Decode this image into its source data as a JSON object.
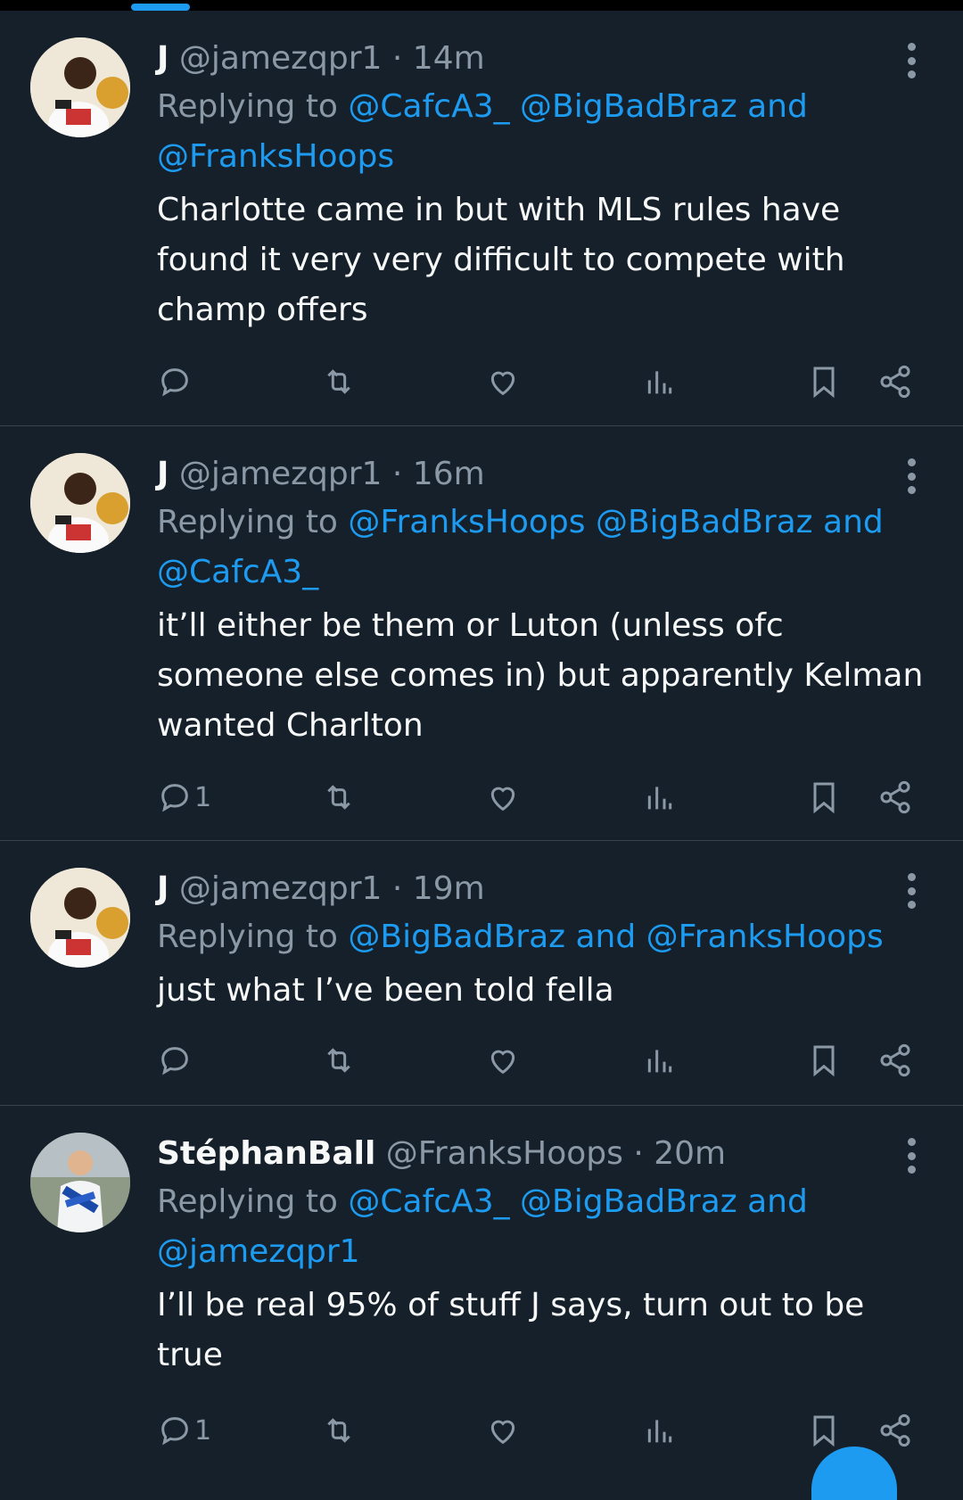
{
  "colors": {
    "background": "#15202b",
    "accent": "#1d9bf0",
    "muted": "#8b98a5",
    "divider": "#38444d"
  },
  "tweets": [
    {
      "name": "J",
      "handle": "@jamezqpr1",
      "time": "· 14m",
      "reply_prefix": "Replying to",
      "reply_line1": "@CafcA3_ @BigBadBraz and",
      "reply_line2": "@FranksHoops",
      "text": "Charlotte came in but with MLS rules have found it very very difficult to compete with champ offers",
      "reply_count": ""
    },
    {
      "name": "J",
      "handle": "@jamezqpr1",
      "time": "· 16m",
      "reply_prefix": "Replying to",
      "reply_line1": "@FranksHoops @BigBadBraz and",
      "reply_line2": "@CafcA3_",
      "text": "it’ll either be them or Luton (unless ofc someone else comes in) but apparently Kelman wanted Charlton",
      "reply_count": "1"
    },
    {
      "name": "J",
      "handle": "@jamezqpr1",
      "time": "· 19m",
      "reply_prefix": "Replying to",
      "reply_line1": "@BigBadBraz and @FranksHoops",
      "reply_line2": "",
      "text": "just what I’ve been told fella",
      "reply_count": ""
    },
    {
      "name": "StéphanBall",
      "handle": "@FranksHoops",
      "time": "· 20m",
      "reply_prefix": "Replying to",
      "reply_line1": "@CafcA3_ @BigBadBraz and",
      "reply_line2": "@jamezqpr1",
      "text": "I’ll be real 95% of stuff J says, turn out to be true",
      "reply_count": "1"
    }
  ],
  "icons": [
    "reply-icon",
    "retweet-icon",
    "like-icon",
    "views-icon",
    "bookmark-icon",
    "share-icon",
    "more-icon"
  ]
}
